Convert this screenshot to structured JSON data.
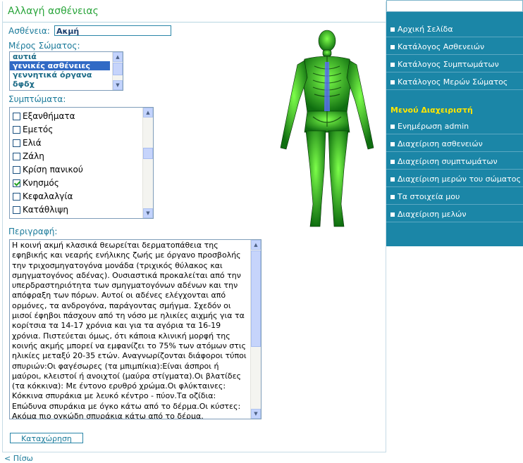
{
  "page": {
    "title": "Αλλαγή ασθένειας",
    "back_link": "< Πίσω"
  },
  "form": {
    "patient_label": "Ασθένεια:",
    "patient_value": "Ακμή",
    "bodypart_label": "Μέρος Σώματος:",
    "bodypart_options": [
      {
        "label": "αυτιά",
        "selected": false
      },
      {
        "label": "γενικές ασθένειες",
        "selected": true
      },
      {
        "label": "γεννητικά όργανα",
        "selected": false
      },
      {
        "label": "δφδχ",
        "selected": false
      }
    ],
    "symptoms_label": "Συμπτώματα:",
    "symptoms": [
      {
        "label": "Εξανθήματα",
        "checked": false
      },
      {
        "label": "Εμετός",
        "checked": false
      },
      {
        "label": "Ελιά",
        "checked": false
      },
      {
        "label": "Ζάλη",
        "checked": false
      },
      {
        "label": "Κρίση πανικού",
        "checked": false
      },
      {
        "label": "Κνησμός",
        "checked": true
      },
      {
        "label": "Κεφαλαλγία",
        "checked": false
      },
      {
        "label": "Κατάθλιψη",
        "checked": false
      }
    ],
    "description_label": "Περιγραφή:",
    "description": "Η κοινή ακμή κλασικά θεωρείται δερματοπάθεια της εφηβικής και νεαρής ενήλικης ζωής με όργανο προσβολής την τριχοσμηγατογόνα μονάδα (τριχικός θύλακος και σμηγματογόνος αδένας). Ουσιαστικά προκαλείται από την υπερδραστηριότητα των σμηγματογόνων αδένων και την απόφραξη των πόρων. Αυτοί οι αδένες ελέγχονται από ορμόνες, τα ανδρογόνα, παράγοντας σμήγμα. Σχεδόν οι μισοί έφηβοι πάσχουν από τη νόσο με ηλικίες αιχμής για τα κορίτσια τα 14-17 χρόνια και για τα αγόρια τα 16-19 χρόνια. Πιστεύεται όμως, ότι κάποια κλινική μορφή της κοινής ακμής μπορεί να εμφανίζει το 75% των ατόμων στις ηλικίες μεταξύ 20-35 ετών. Αναγνωρίζονται διάφοροι τύποι σπυριών:Οι φαγέσωρες (τα μπιμπίκια):Είναι άσπροι ή μαύροι, κλειστοί ή ανοιχτοί (μαύρα στίγματα).Οι βλατίδες (τα κόκκινα): Με έντονο ερυθρό χρώμα.Οι φλύκταινες: Κόκκινα σπυράκια με λευκό κέντρο - πύον.Τα οζίδια: Επώδυνα σπυράκια με όγκο κάτω από το δέρμα.Οι κύστες: Ακόμα πιο ογκώδη σπυράκια κάτω από το δέρμα. Εντοπίζονται κυρίως",
    "submit_label": "Καταχώρηση"
  },
  "sidebar": {
    "nav_items": [
      "Αρχική Σελίδα",
      "Κατάλογος Ασθενειών",
      "Κατάλογος Συμπτωμάτων",
      "Κατάλογος Μερών Σώματος"
    ],
    "admin_heading": "Μενού Διαχειριστή",
    "admin_items": [
      "Ενημέρωση admin",
      "Διαχείριση ασθενειών",
      "Διαχείριση συμπτωμάτων",
      "Διαχείριση μερών του σώματος",
      "Τα στοιχεία μου",
      "Διαχείριση μελών"
    ]
  },
  "colors": {
    "accent_green": "#2aa53b",
    "label_teal": "#1a7a9a",
    "sidebar_bg": "#1b86a7",
    "admin_heading": "#ffe600",
    "selection": "#316ac5"
  }
}
